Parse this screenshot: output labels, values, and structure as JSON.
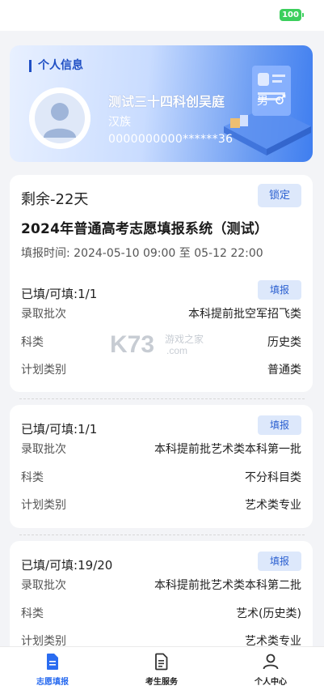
{
  "status_bar": {
    "battery": "100"
  },
  "profile": {
    "section_title": "个人信息",
    "name": "测试三十四科创吴庭",
    "gender": "男",
    "ethnicity": "汉族",
    "id_number": "0000000000******36"
  },
  "main": {
    "remaining": "剩余-22天",
    "lock_label": "锁定",
    "title": "2024年普通高考志愿填报系统（测试）",
    "fill_time": "填报时间:  2024-05-10 09:00 至 05-12 22:00"
  },
  "batches": [
    {
      "filled": "已填/可填:1/1",
      "button": "填报",
      "rows": [
        {
          "key": "录取批次",
          "value": "本科提前批空军招飞类"
        },
        {
          "key": "科类",
          "value": "历史类"
        },
        {
          "key": "计划类别",
          "value": "普通类"
        }
      ]
    },
    {
      "filled": "已填/可填:1/1",
      "button": "填报",
      "rows": [
        {
          "key": "录取批次",
          "value": "本科提前批艺术类本科第一批"
        },
        {
          "key": "科类",
          "value": "不分科目类"
        },
        {
          "key": "计划类别",
          "value": "艺术类专业"
        }
      ]
    },
    {
      "filled": "已填/可填:19/20",
      "button": "填报",
      "rows": [
        {
          "key": "录取批次",
          "value": "本科提前批艺术类本科第二批"
        },
        {
          "key": "科类",
          "value": "艺术(历史类)"
        },
        {
          "key": "计划类别",
          "value": "艺术类专业"
        }
      ]
    }
  ],
  "watermark": {
    "brand": "K73",
    "site": "游戏之家",
    "domain": ".com"
  },
  "bottom_nav": [
    {
      "label": "志愿填报",
      "icon": "document-icon",
      "active": true
    },
    {
      "label": "考生服务",
      "icon": "form-icon",
      "active": false
    },
    {
      "label": "个人中心",
      "icon": "user-icon",
      "active": false
    }
  ],
  "colors": {
    "accent": "#2a6cf0",
    "button_bg": "#dde8fb",
    "battery": "#3ccf5d"
  }
}
